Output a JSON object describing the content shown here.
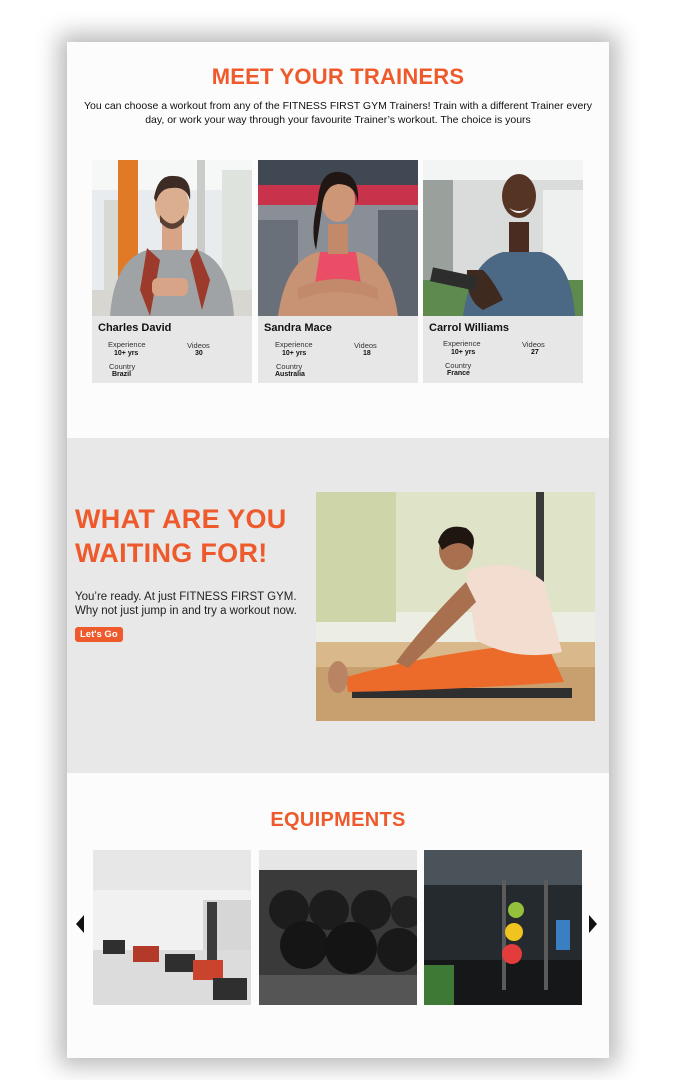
{
  "trainers_section": {
    "title": "MEET YOUR TRAINERS",
    "intro": "You can choose a workout from any of the FITNESS FIRST GYM  Trainers! Train with a different Trainer every day, or work your way through your favourite Trainer’s workout. The choice is yours",
    "cards": [
      {
        "name": "Charles David",
        "experience_label": "Experience",
        "experience": "10+ yrs",
        "videos_label": "Videos",
        "videos": "30",
        "country_label": "Country",
        "country": "Brazil"
      },
      {
        "name": "Sandra Mace",
        "experience_label": "Experience",
        "experience": "10+ yrs",
        "videos_label": "Videos",
        "videos": "18",
        "country_label": "Country",
        "country": "Australia"
      },
      {
        "name": "Carrol Williams",
        "experience_label": "Experience",
        "experience": "10+ yrs",
        "videos_label": "Videos",
        "videos": "27",
        "country_label": "Country",
        "country": "France"
      }
    ]
  },
  "cta_section": {
    "title_line1": "WHAT ARE YOU",
    "title_line2": "WAITING FOR!",
    "copy_line1": "You’re ready. At just FITNESS FIRST GYM.",
    "copy_line2": "Why not just jump in and try a workout now.",
    "button_label": "Let's Go"
  },
  "equipments_section": {
    "title": "EQUIPMENTS",
    "images": [
      "gym-floor-photo",
      "kettlebells-photo",
      "weight-rack-photo"
    ],
    "prev_icon": "chevron-left-icon",
    "next_icon": "chevron-right-icon"
  },
  "colors": {
    "accent": "#ee5a2b",
    "card_bg": "#e7e7e7",
    "band_bg": "#e8e8e9"
  }
}
